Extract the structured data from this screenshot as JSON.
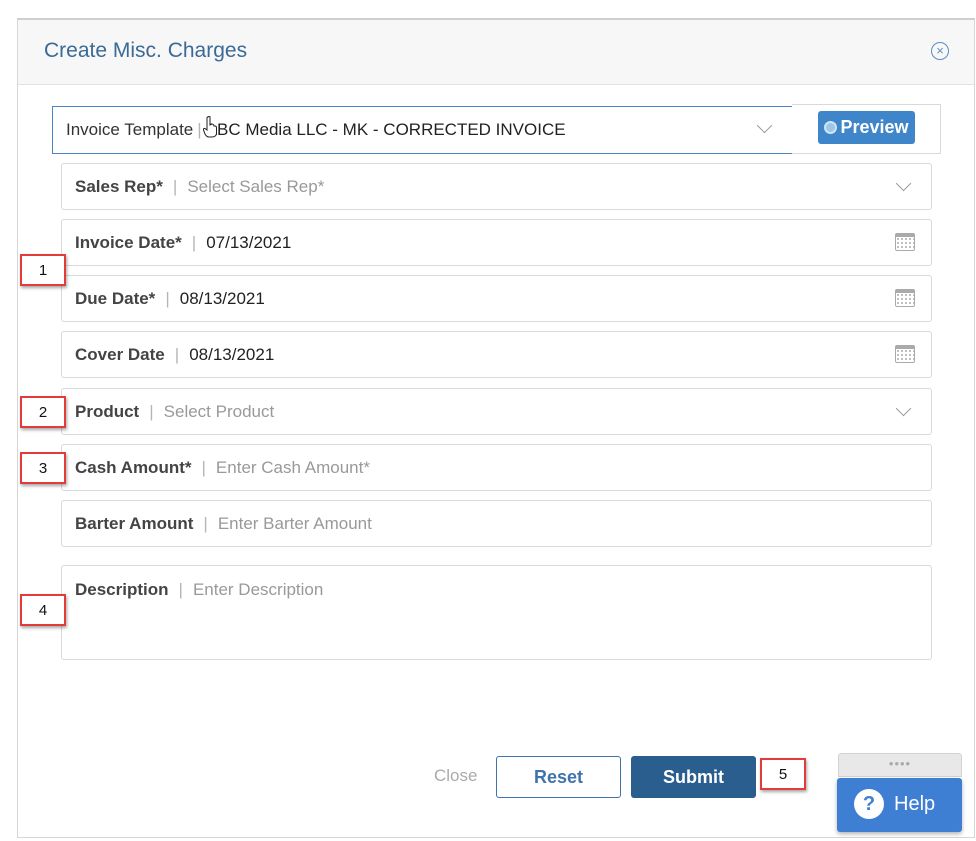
{
  "dialog": {
    "title": "Create Misc. Charges",
    "close_icon": "close-circle-icon"
  },
  "invoice_template": {
    "label": "Invoice Template",
    "value": "ABC Media LLC - MK - CORRECTED INVOICE",
    "preview_label": "Preview"
  },
  "fields": {
    "sales_rep": {
      "label": "Sales Rep*",
      "placeholder": "Select Sales Rep*"
    },
    "invoice_date": {
      "label": "Invoice Date*",
      "value": "07/13/2021"
    },
    "due_date": {
      "label": "Due Date*",
      "value": "08/13/2021"
    },
    "cover_date": {
      "label": "Cover Date",
      "value": "08/13/2021"
    },
    "product": {
      "label": "Product",
      "placeholder": "Select Product"
    },
    "cash_amount": {
      "label": "Cash Amount*",
      "placeholder": "Enter Cash Amount*"
    },
    "barter_amount": {
      "label": "Barter Amount",
      "placeholder": "Enter Barter Amount"
    },
    "description": {
      "label": "Description",
      "placeholder": "Enter Description"
    }
  },
  "separator": "|",
  "buttons": {
    "close": "Close",
    "reset": "Reset",
    "submit": "Submit"
  },
  "help": {
    "grip": "••••",
    "icon": "?",
    "label": "Help"
  },
  "callouts": [
    "1",
    "2",
    "3",
    "4",
    "5"
  ]
}
